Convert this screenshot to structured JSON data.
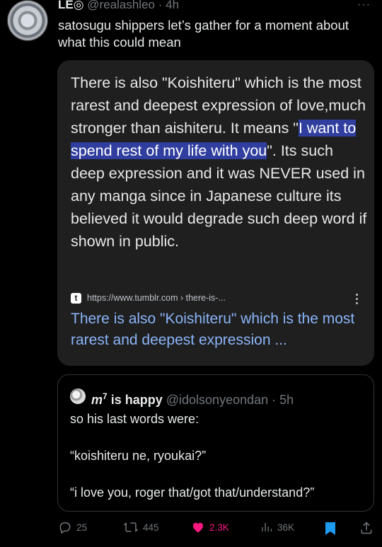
{
  "tweet": {
    "display_name": "LE◎",
    "handle": "@realashleo",
    "time": "4h",
    "text": "satosugu shippers let’s gather for a moment about what this could mean"
  },
  "card": {
    "text_before": "There is also \"Koishiteru\" which is the most rarest and deepest expression of love,much stronger than aishiteru. It means \"",
    "highlight": "I want to spend rest of my life with you",
    "text_after": "\". Its such deep expression and it was NEVER used in any manga since in Japanese culture its believed it would degrade such deep word if shown in public.",
    "source_icon_letter": "t",
    "source_url": "https://www.tumblr.com › there-is-...",
    "link_title": "There is also \"Koishiteru\" which is the most rarest and deepest expression ..."
  },
  "quoted_tweet": {
    "display_name": "m",
    "name_sup": "7",
    "name_suffix": " is happy",
    "handle": "@idolsonyeondan",
    "time": "5h",
    "lines": [
      "so his last words were:",
      "“koishiteru ne, ryoukai?”",
      "“i love you, roger that/got that/understand?”"
    ]
  },
  "actions": {
    "replies": "25",
    "reposts": "445",
    "likes": "2.3K",
    "views": "36K"
  },
  "colors": {
    "background": "#000000",
    "link": "#8ab4f8",
    "highlight": "#303f9f",
    "like": "#f91880",
    "bookmark": "#1d9bf0"
  }
}
